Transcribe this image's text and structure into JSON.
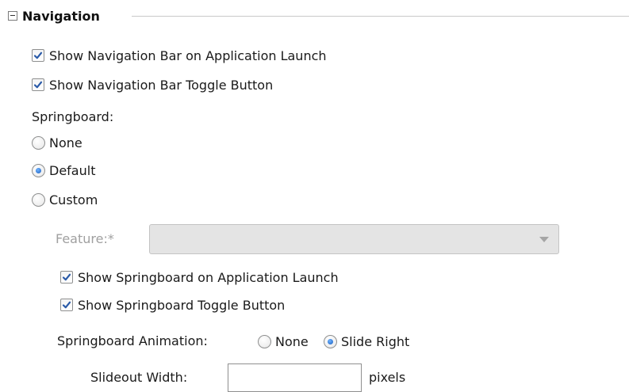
{
  "section": {
    "title": "Navigation"
  },
  "nav_options": [
    {
      "label": "Show Navigation Bar on Application Launch",
      "checked": true
    },
    {
      "label": "Show Navigation Bar Toggle Button",
      "checked": true
    }
  ],
  "springboard": {
    "label": "Springboard:",
    "options": [
      {
        "label": "None",
        "selected": false
      },
      {
        "label": "Default",
        "selected": true
      },
      {
        "label": "Custom",
        "selected": false
      }
    ]
  },
  "feature": {
    "label": "Feature:*",
    "value": "",
    "disabled": true
  },
  "springboard_options": [
    {
      "label": "Show Springboard on Application Launch",
      "checked": true
    },
    {
      "label": "Show Springboard Toggle Button",
      "checked": true
    }
  ],
  "animation": {
    "label": "Springboard Animation:",
    "options": [
      {
        "label": "None",
        "selected": false
      },
      {
        "label": "Slide Right",
        "selected": true
      }
    ]
  },
  "slideout": {
    "label": "Slideout Width:",
    "value": "",
    "unit": "pixels"
  },
  "colors": {
    "check_mark": "#2a5aa8",
    "disabled_text": "#a0a0a0"
  }
}
